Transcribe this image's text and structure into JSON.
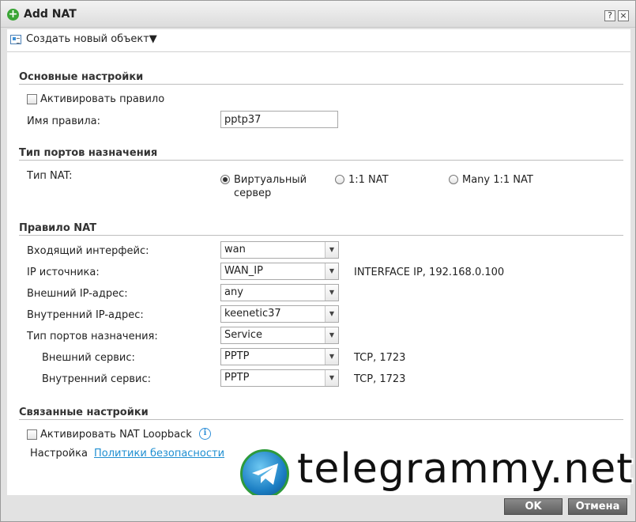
{
  "window": {
    "title": "Add NAT",
    "help_glyph": "?",
    "close_glyph": "×"
  },
  "toolbar": {
    "create_label": "Создать новый объект▼"
  },
  "basic": {
    "title": "Основные настройки",
    "activate_label": "Активировать правило",
    "rule_name_label": "Имя правила:",
    "rule_name_value": "pptp37"
  },
  "port_type": {
    "title": "Тип портов назначения",
    "nat_type_label": "Тип NAT:",
    "options": [
      "Виртуальный",
      "сервер",
      "1:1 NAT",
      "Many 1:1 NAT"
    ]
  },
  "nat_rule": {
    "title": "Правило NAT",
    "rows": [
      {
        "label": "Входящий интерфейс:",
        "value": "wan",
        "info": ""
      },
      {
        "label": "IP источника:",
        "value": "WAN_IP",
        "info": "INTERFACE IP, 192.168.0.100"
      },
      {
        "label": "Внешний IP-адрес:",
        "value": "any",
        "info": ""
      },
      {
        "label": "Внутренний IP-адрес:",
        "value": "keenetic37",
        "info": ""
      },
      {
        "label": "Тип портов назначения:",
        "value": "Service",
        "info": ""
      },
      {
        "label": "Внешний сервис:",
        "value": "PPTP",
        "info": "TCP, 1723"
      },
      {
        "label": "Внутренний сервис:",
        "value": "PPTP",
        "info": "TCP, 1723"
      }
    ]
  },
  "related": {
    "title": "Связанные настройки",
    "loopback_label": "Активировать NAT Loopback",
    "policy_prefix": "Настройка",
    "policy_link": "Политики безопасности"
  },
  "watermark": {
    "text": "telegrammy.net"
  },
  "footer": {
    "ok_label": "OK",
    "cancel_label": "Отмена"
  },
  "colors": {
    "accent_green": "#3aa536",
    "link_blue": "#1f8fd1",
    "button_gray": "#6e6e6e"
  }
}
